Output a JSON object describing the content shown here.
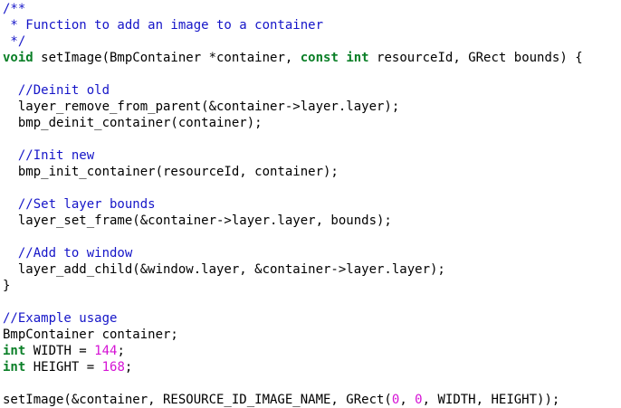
{
  "editor": {
    "colors": {
      "comment": "#1515c8",
      "keyword": "#0a7f27",
      "number": "#d512d5",
      "plain": "#000000",
      "background": "#ffffff"
    },
    "lines": [
      [
        {
          "t": "/**",
          "k": "comment"
        }
      ],
      [
        {
          "t": " * Function to add an image to a container",
          "k": "comment"
        }
      ],
      [
        {
          "t": " */",
          "k": "comment"
        }
      ],
      [
        {
          "t": "void",
          "k": "keyword"
        },
        {
          "t": " setImage(BmpContainer *container, ",
          "k": "plain"
        },
        {
          "t": "const",
          "k": "keyword"
        },
        {
          "t": " ",
          "k": "plain"
        },
        {
          "t": "int",
          "k": "keyword"
        },
        {
          "t": " resourceId, GRect bounds) {",
          "k": "plain"
        }
      ],
      [],
      [
        {
          "t": "  //Deinit old",
          "k": "comment"
        }
      ],
      [
        {
          "t": "  layer_remove_from_parent(&container->layer.layer);",
          "k": "plain"
        }
      ],
      [
        {
          "t": "  bmp_deinit_container(container);",
          "k": "plain"
        }
      ],
      [],
      [
        {
          "t": "  //Init new",
          "k": "comment"
        }
      ],
      [
        {
          "t": "  bmp_init_container(resourceId, container);",
          "k": "plain"
        }
      ],
      [],
      [
        {
          "t": "  //Set layer bounds",
          "k": "comment"
        }
      ],
      [
        {
          "t": "  layer_set_frame(&container->layer.layer, bounds);",
          "k": "plain"
        }
      ],
      [],
      [
        {
          "t": "  //Add to window",
          "k": "comment"
        }
      ],
      [
        {
          "t": "  layer_add_child(&window.layer, &container->layer.layer);",
          "k": "plain"
        }
      ],
      [
        {
          "t": "}",
          "k": "plain"
        }
      ],
      [],
      [
        {
          "t": "//Example usage",
          "k": "comment"
        }
      ],
      [
        {
          "t": "BmpContainer container;",
          "k": "plain"
        }
      ],
      [
        {
          "t": "int",
          "k": "keyword"
        },
        {
          "t": " WIDTH = ",
          "k": "plain"
        },
        {
          "t": "144",
          "k": "number"
        },
        {
          "t": ";",
          "k": "plain"
        }
      ],
      [
        {
          "t": "int",
          "k": "keyword"
        },
        {
          "t": " HEIGHT = ",
          "k": "plain"
        },
        {
          "t": "168",
          "k": "number"
        },
        {
          "t": ";",
          "k": "plain"
        }
      ],
      [],
      [
        {
          "t": "setImage(&container, RESOURCE_ID_IMAGE_NAME, GRect(",
          "k": "plain"
        },
        {
          "t": "0",
          "k": "number"
        },
        {
          "t": ", ",
          "k": "plain"
        },
        {
          "t": "0",
          "k": "number"
        },
        {
          "t": ", WIDTH, HEIGHT));",
          "k": "plain"
        }
      ]
    ]
  }
}
